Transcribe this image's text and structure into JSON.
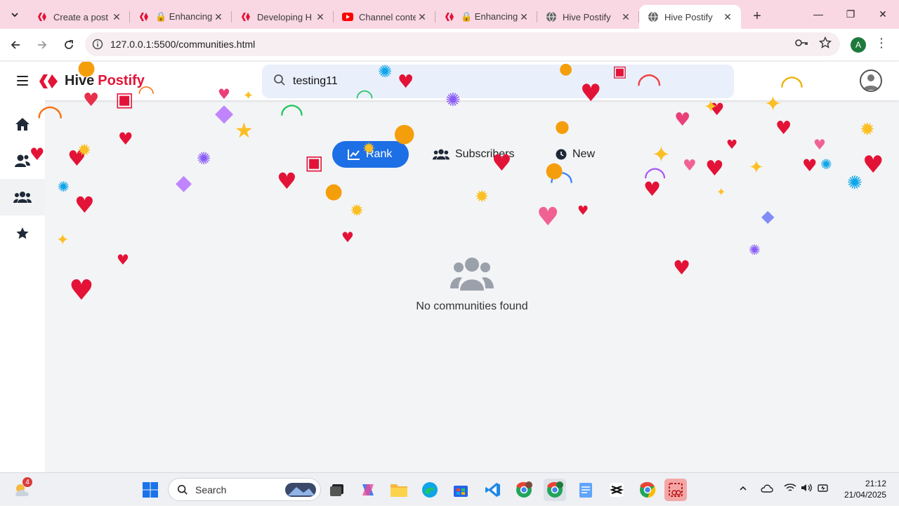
{
  "browser": {
    "tabs": [
      {
        "label": "Create a post",
        "favicon": "hive-icon",
        "active": false
      },
      {
        "label": "🔒 Enhancing",
        "favicon": "hive-icon",
        "active": false
      },
      {
        "label": "Developing H",
        "favicon": "hive-icon",
        "active": false
      },
      {
        "label": "Channel conte",
        "favicon": "youtube-icon",
        "active": false
      },
      {
        "label": "🔒 Enhancing",
        "favicon": "hive-icon",
        "active": false
      },
      {
        "label": "Hive Postify",
        "favicon": "globe-icon",
        "active": false
      },
      {
        "label": "Hive Postify",
        "favicon": "globe-icon",
        "active": true
      }
    ],
    "url": "127.0.0.1:5500/communities.html",
    "profile_initial": "A",
    "accent": "#f9d7e3"
  },
  "app": {
    "brand": {
      "part1": "Hive",
      "part2": "Postify",
      "color": "#e31337"
    },
    "search": {
      "value": "testing11"
    },
    "sidebar": [
      {
        "name": "home",
        "icon": "home-icon",
        "active": false
      },
      {
        "name": "users",
        "icon": "users-icon",
        "active": false
      },
      {
        "name": "communities",
        "icon": "communities-icon",
        "active": true
      },
      {
        "name": "favorites",
        "icon": "star-icon",
        "active": false
      }
    ],
    "sort": {
      "rank": "Rank",
      "subscribers": "Subscribers",
      "new": "New",
      "active_color": "#1d6fe5"
    },
    "empty_state": {
      "icon": "users-icon",
      "text": "No communities found"
    }
  },
  "taskbar": {
    "weather_badge": "4",
    "search_placeholder": "Search",
    "apps": [
      "windows-start-icon",
      "task-view-icon",
      "copilot-icon",
      "file-explorer-icon",
      "edge-icon",
      "store-icon",
      "vscode-icon",
      "chrome-profile-icon",
      "chrome-active-icon",
      "notepad-icon",
      "capcut-icon",
      "chrome-icon",
      "snipping-tool-icon"
    ],
    "time": "21:12",
    "date": "21/04/2025"
  }
}
